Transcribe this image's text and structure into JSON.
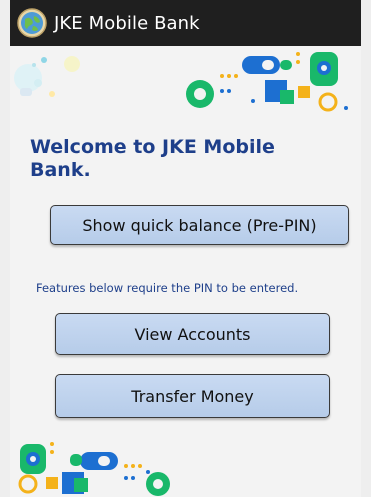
{
  "app": {
    "title": "JKE Mobile Bank",
    "icon": "globe-app-icon"
  },
  "main": {
    "welcome": "Welcome to JKE Mobile Bank.",
    "quick_balance_label": "Show quick balance (Pre-PIN)",
    "pin_note": "Features below require the PIN to be entered.",
    "view_accounts_label": "View Accounts",
    "transfer_money_label": "Transfer Money"
  },
  "colors": {
    "titlebar": "#1f1f1f",
    "heading_blue": "#1e3f8a",
    "button_fill": "#c1d4ee",
    "accent_green": "#19b86a",
    "accent_blue": "#1d6fd1",
    "accent_yellow": "#f4b21a"
  }
}
